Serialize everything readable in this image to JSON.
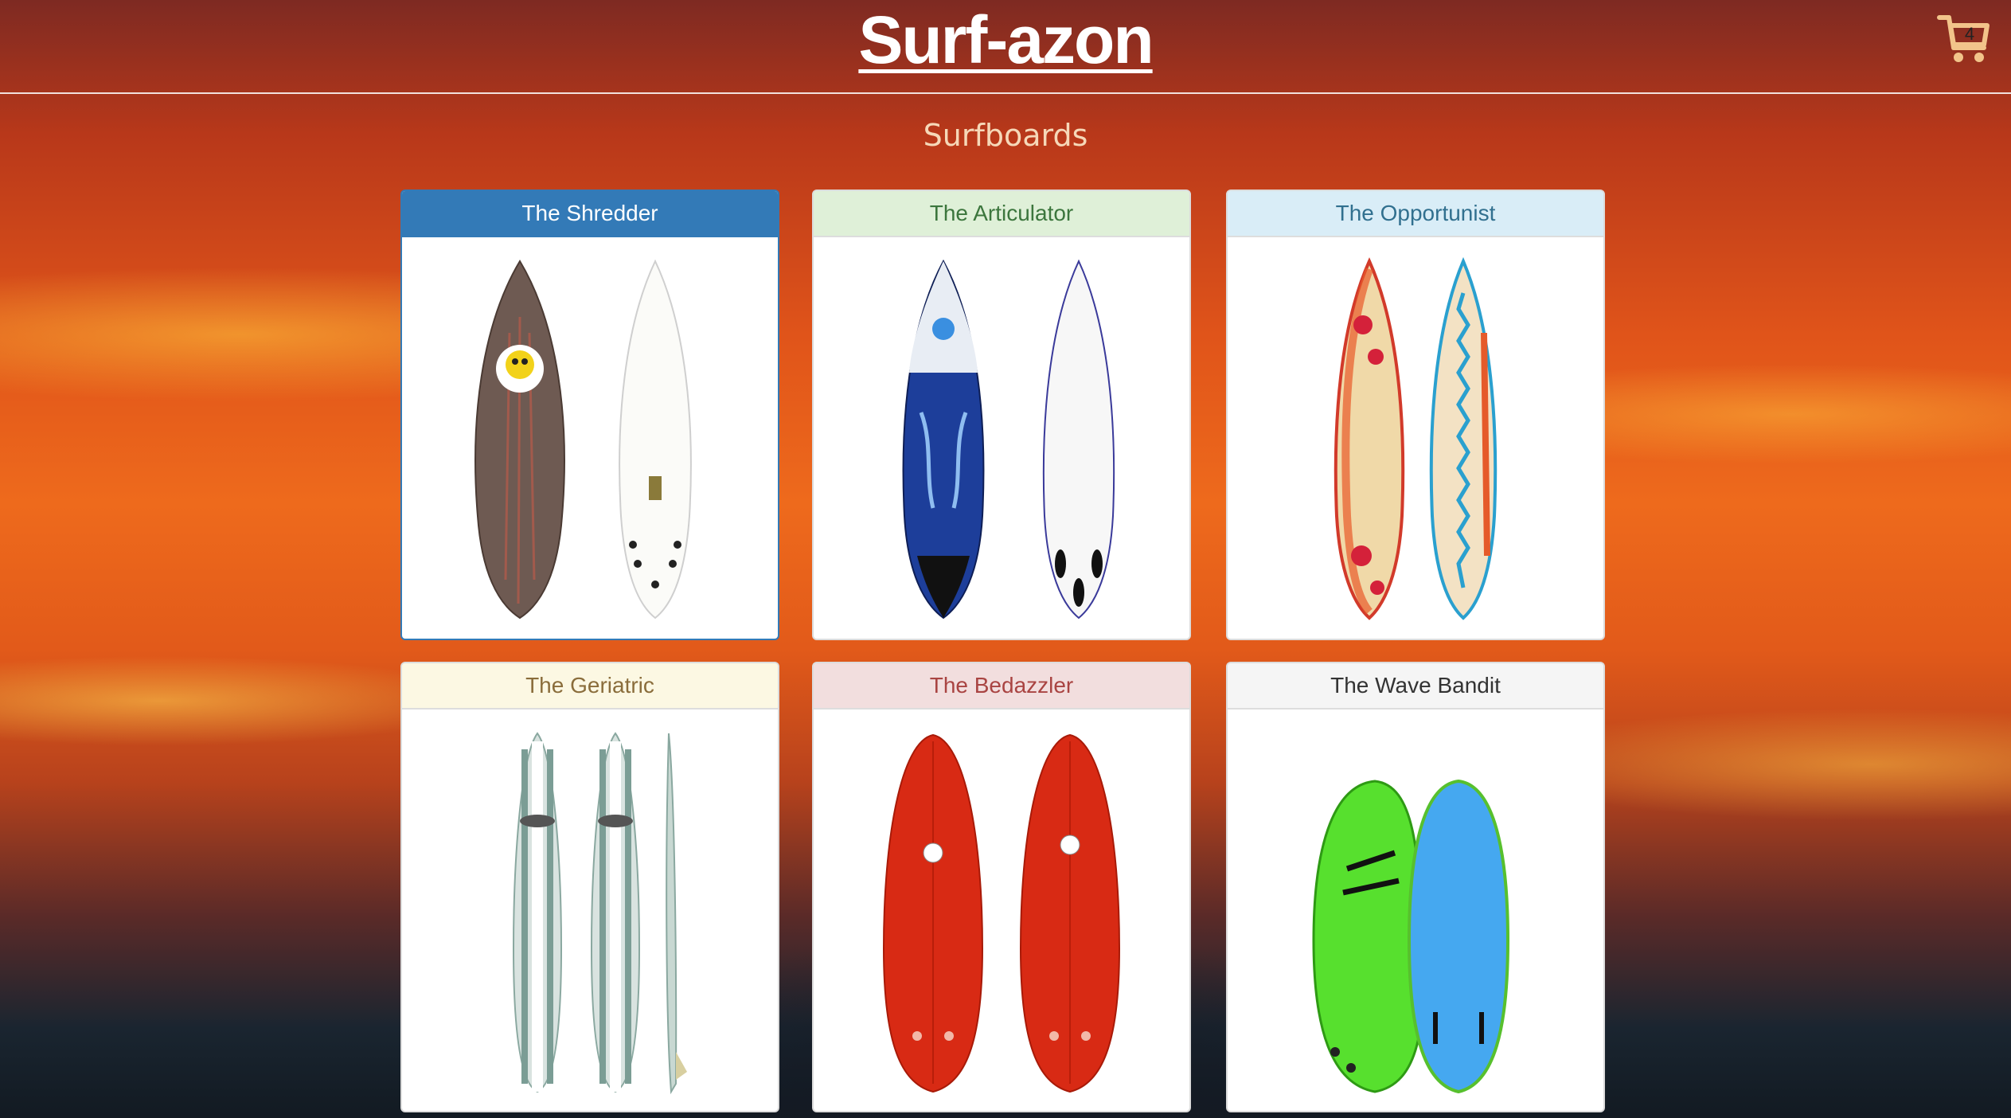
{
  "header": {
    "title": "Surf-azon",
    "cart_count": "4",
    "cart_icon": "shopping-cart-icon"
  },
  "main": {
    "heading": "Surfboards"
  },
  "products": [
    {
      "name": "The Shredder",
      "header_bg": "#337ab7",
      "header_fg": "#ffffff",
      "selected": true
    },
    {
      "name": "The Articulator",
      "header_bg": "#dff0d8",
      "header_fg": "#3c763d"
    },
    {
      "name": "The Opportunist",
      "header_bg": "#d9edf7",
      "header_fg": "#31708f"
    },
    {
      "name": "The Geriatric",
      "header_bg": "#fcf8e3",
      "header_fg": "#8a6d3b"
    },
    {
      "name": "The Bedazzler",
      "header_bg": "#f2dede",
      "header_fg": "#a94442"
    },
    {
      "name": "The Wave Bandit",
      "header_bg": "#f5f5f5",
      "header_fg": "#333333"
    }
  ]
}
